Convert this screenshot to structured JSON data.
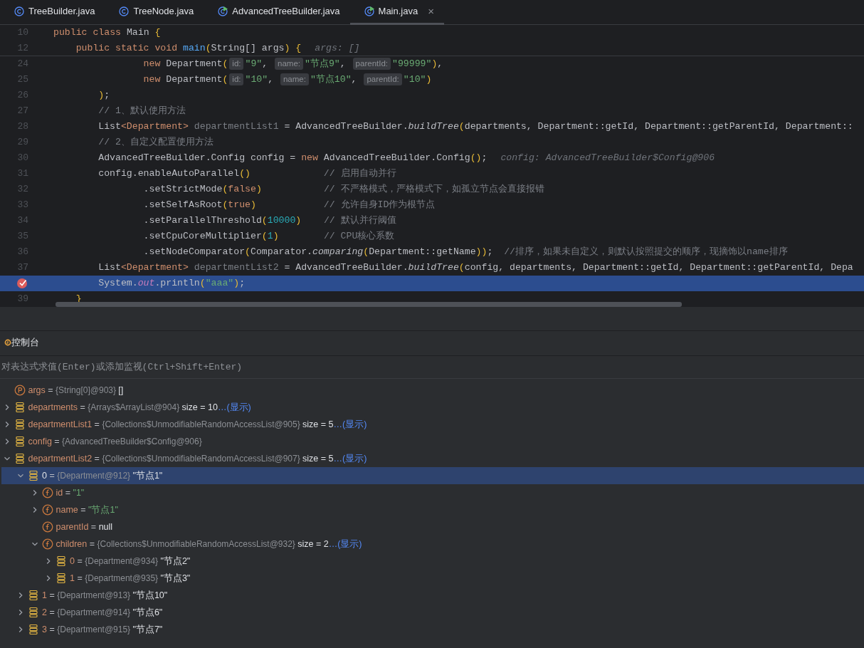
{
  "tabs": [
    {
      "label": "TreeBuilder.java",
      "kind": "class",
      "selected": false,
      "closable": false
    },
    {
      "label": "TreeNode.java",
      "kind": "class",
      "selected": false,
      "closable": false
    },
    {
      "label": "AdvancedTreeBuilder.java",
      "kind": "runnable",
      "selected": false,
      "closable": false
    },
    {
      "label": "Main.java",
      "kind": "runnable",
      "selected": true,
      "closable": true
    }
  ],
  "close_glyph": "×",
  "sticky_lines": [
    {
      "num": "10",
      "tokens": [
        {
          "kind": "kw",
          "text": "public class "
        },
        {
          "kind": "plain",
          "text": "Main "
        },
        {
          "kind": "brace",
          "text": "{"
        }
      ]
    },
    {
      "num": "12",
      "tokens": [
        {
          "kind": "kw",
          "text": "    public static void "
        },
        {
          "kind": "decl",
          "text": "main"
        },
        {
          "kind": "brace",
          "text": "("
        },
        {
          "kind": "plain",
          "text": "String[] args"
        },
        {
          "kind": "brace",
          "text": ")"
        },
        {
          "kind": "brace",
          "text": " {"
        },
        {
          "kind": "value",
          "text": "args: []"
        }
      ]
    }
  ],
  "lines": [
    {
      "num": "24",
      "breakpoint": false,
      "current": false,
      "tokens": [
        {
          "kind": "kw",
          "text": "                new "
        },
        {
          "kind": "plain",
          "text": "Department"
        },
        {
          "kind": "brace",
          "text": "("
        },
        {
          "kind": "hint",
          "text": "id:"
        },
        {
          "kind": "str",
          "text": "\"9\""
        },
        {
          "kind": "plain",
          "text": ", "
        },
        {
          "kind": "hint",
          "text": "name:"
        },
        {
          "kind": "str",
          "text": "\"节点9\""
        },
        {
          "kind": "plain",
          "text": ", "
        },
        {
          "kind": "hint",
          "text": "parentId:"
        },
        {
          "kind": "str",
          "text": "\"99999\""
        },
        {
          "kind": "brace",
          "text": ")"
        },
        {
          "kind": "plain",
          "text": ","
        }
      ]
    },
    {
      "num": "25",
      "breakpoint": false,
      "current": false,
      "tokens": [
        {
          "kind": "kw",
          "text": "                new "
        },
        {
          "kind": "plain",
          "text": "Department"
        },
        {
          "kind": "brace",
          "text": "("
        },
        {
          "kind": "hint",
          "text": "id:"
        },
        {
          "kind": "str",
          "text": "\"10\""
        },
        {
          "kind": "plain",
          "text": ", "
        },
        {
          "kind": "hint",
          "text": "name:"
        },
        {
          "kind": "str",
          "text": "\"节点10\""
        },
        {
          "kind": "plain",
          "text": ", "
        },
        {
          "kind": "hint",
          "text": "parentId:"
        },
        {
          "kind": "str",
          "text": "\"10\""
        },
        {
          "kind": "brace",
          "text": ")"
        }
      ]
    },
    {
      "num": "26",
      "breakpoint": false,
      "current": false,
      "tokens": [
        {
          "kind": "brace",
          "text": "        )"
        },
        {
          "kind": "plain",
          "text": ";"
        }
      ]
    },
    {
      "num": "27",
      "breakpoint": false,
      "current": false,
      "tokens": [
        {
          "kind": "comment",
          "text": "        // 1、默认使用方法"
        }
      ]
    },
    {
      "num": "28",
      "breakpoint": false,
      "current": false,
      "tokens": [
        {
          "kind": "plain",
          "text": "        List"
        },
        {
          "kind": "kw",
          "text": "<Department>"
        },
        {
          "kind": "dim",
          "text": " departmentList1"
        },
        {
          "kind": "plain",
          "text": " = AdvancedTreeBuilder."
        },
        {
          "kind": "italic",
          "text": "buildTree"
        },
        {
          "kind": "brace",
          "text": "("
        },
        {
          "kind": "plain",
          "text": "departments, Department::getId, Department::getParentId, Department::"
        }
      ]
    },
    {
      "num": "29",
      "breakpoint": false,
      "current": false,
      "tokens": [
        {
          "kind": "comment",
          "text": "        // 2、自定义配置使用方法"
        }
      ]
    },
    {
      "num": "30",
      "breakpoint": false,
      "current": false,
      "tokens": [
        {
          "kind": "plain",
          "text": "        AdvancedTreeBuilder.Config config = "
        },
        {
          "kind": "kw",
          "text": "new"
        },
        {
          "kind": "plain",
          "text": " AdvancedTreeBuilder.Config"
        },
        {
          "kind": "brace",
          "text": "()"
        },
        {
          "kind": "plain",
          "text": ";"
        },
        {
          "kind": "value",
          "text": "config: AdvancedTreeBuilder$Config@906"
        }
      ]
    },
    {
      "num": "31",
      "breakpoint": false,
      "current": false,
      "tokens": [
        {
          "kind": "plain",
          "text": "        config.enableAutoParallel"
        },
        {
          "kind": "brace",
          "text": "()"
        },
        {
          "kind": "acomment",
          "text": "// 启用自动并行"
        }
      ]
    },
    {
      "num": "32",
      "breakpoint": false,
      "current": false,
      "tokens": [
        {
          "kind": "plain",
          "text": "                .setStrictMode"
        },
        {
          "kind": "brace",
          "text": "("
        },
        {
          "kind": "kw",
          "text": "false"
        },
        {
          "kind": "brace",
          "text": ")"
        },
        {
          "kind": "acomment",
          "text": "// 不严格模式，严格模式下，如孤立节点会直接报错"
        }
      ]
    },
    {
      "num": "33",
      "breakpoint": false,
      "current": false,
      "tokens": [
        {
          "kind": "plain",
          "text": "                .setSelfAsRoot"
        },
        {
          "kind": "brace",
          "text": "("
        },
        {
          "kind": "kw",
          "text": "true"
        },
        {
          "kind": "brace",
          "text": ")"
        },
        {
          "kind": "acomment",
          "text": "// 允许自身ID作为根节点"
        }
      ]
    },
    {
      "num": "34",
      "breakpoint": false,
      "current": false,
      "tokens": [
        {
          "kind": "plain",
          "text": "                .setParallelThreshold"
        },
        {
          "kind": "brace",
          "text": "("
        },
        {
          "kind": "num",
          "text": "10000"
        },
        {
          "kind": "brace",
          "text": ")"
        },
        {
          "kind": "acomment",
          "text": "// 默认并行阈值"
        }
      ]
    },
    {
      "num": "35",
      "breakpoint": false,
      "current": false,
      "tokens": [
        {
          "kind": "plain",
          "text": "                .setCpuCoreMultiplier"
        },
        {
          "kind": "brace",
          "text": "("
        },
        {
          "kind": "num",
          "text": "1"
        },
        {
          "kind": "brace",
          "text": ")"
        },
        {
          "kind": "acomment",
          "text": "// CPU核心系数"
        }
      ]
    },
    {
      "num": "36",
      "breakpoint": false,
      "current": false,
      "tokens": [
        {
          "kind": "plain",
          "text": "                .setNodeComparator"
        },
        {
          "kind": "brace",
          "text": "("
        },
        {
          "kind": "plain",
          "text": "Comparator."
        },
        {
          "kind": "italic",
          "text": "comparing"
        },
        {
          "kind": "brace",
          "text": "("
        },
        {
          "kind": "plain",
          "text": "Department::getName"
        },
        {
          "kind": "brace",
          "text": "))"
        },
        {
          "kind": "plain",
          "text": ";"
        },
        {
          "kind": "ecomment",
          "text": "//排序，如果未自定义，则默认按照提交的顺序，现摘饰以name排序"
        }
      ]
    },
    {
      "num": "37",
      "breakpoint": false,
      "current": false,
      "tokens": [
        {
          "kind": "plain",
          "text": "        List"
        },
        {
          "kind": "kw",
          "text": "<Department>"
        },
        {
          "kind": "dim",
          "text": " departmentList2"
        },
        {
          "kind": "plain",
          "text": " = AdvancedTreeBuilder."
        },
        {
          "kind": "italic",
          "text": "buildTree"
        },
        {
          "kind": "brace",
          "text": "("
        },
        {
          "kind": "plain",
          "text": "config, departments, Department::getId, Department::getParentId, Depa"
        }
      ]
    },
    {
      "breakpoint": true,
      "current": true,
      "tokens": [
        {
          "kind": "plain",
          "text": "        System."
        },
        {
          "kind": "field",
          "text": "out"
        },
        {
          "kind": "plain",
          "text": ".println"
        },
        {
          "kind": "brace",
          "text": "("
        },
        {
          "kind": "str",
          "text": "\"aaa\""
        },
        {
          "kind": "brace",
          "text": ")"
        },
        {
          "kind": "plain",
          "text": ";"
        }
      ]
    },
    {
      "num": "39",
      "breakpoint": false,
      "current": false,
      "tokens": [
        {
          "kind": "brace",
          "text": "    }"
        }
      ]
    }
  ],
  "panel": {
    "tab_label": "控制台",
    "evaluate_placeholder": "对表达式求值(Enter)或添加监视(Ctrl+Shift+Enter)"
  },
  "variables": [
    {
      "kind": "param",
      "name": "args",
      "assign": "=",
      "type": "{String[0]@903}",
      "value": "[]",
      "selected": false
    },
    {
      "kind": "list",
      "name": "departments",
      "assign": "=",
      "type": "{Arrays$ArrayList@904}",
      "value": "size = 10",
      "link": "…(显示)",
      "expanded": false,
      "selected": false
    },
    {
      "kind": "list",
      "name": "departmentList1",
      "assign": "=",
      "type": "{Collections$UnmodifiableRandomAccessList@905}",
      "value": "size = 5",
      "link": "…(显示)",
      "expanded": false,
      "selected": false
    },
    {
      "kind": "list",
      "name": "config",
      "assign": "=",
      "type": "{AdvancedTreeBuilder$Config@906}",
      "expanded": false,
      "selected": false
    },
    {
      "kind": "list",
      "name": "departmentList2",
      "assign": "=",
      "type": "{Collections$UnmodifiableRandomAccessList@907}",
      "value": "size = 5",
      "link": "…(显示)",
      "expanded": true,
      "selected": false,
      "children": [
        {
          "kind": "list",
          "name": "0",
          "assign": "=",
          "type": "{Department@912}",
          "value": "\"节点1\"",
          "expanded": true,
          "selected": true,
          "children": [
            {
              "kind": "field",
              "name": "id",
              "assign": "=",
              "value": {
                "kind": "string",
                "text": "\"1\""
              },
              "expanded": false,
              "selected": false
            },
            {
              "kind": "field",
              "name": "name",
              "assign": "=",
              "value": {
                "kind": "string",
                "text": "\"节点1\""
              },
              "expanded": false,
              "selected": false
            },
            {
              "kind": "field",
              "name": "parentId",
              "assign": "=",
              "value": "null",
              "selected": false
            },
            {
              "kind": "field",
              "name": "children",
              "assign": "=",
              "type": "{Collections$UnmodifiableRandomAccessList@932}",
              "value": "size = 2",
              "link": "…(显示)",
              "expanded": true,
              "selected": false,
              "children": [
                {
                  "kind": "list",
                  "name": "0",
                  "assign": "=",
                  "type": "{Department@934}",
                  "value": "\"节点2\"",
                  "expanded": false,
                  "selected": false
                },
                {
                  "kind": "list",
                  "name": "1",
                  "assign": "=",
                  "type": "{Department@935}",
                  "value": "\"节点3\"",
                  "expanded": false,
                  "selected": false
                }
              ]
            }
          ]
        },
        {
          "kind": "list",
          "name": "1",
          "assign": "=",
          "type": "{Department@913}",
          "value": "\"节点10\"",
          "expanded": false,
          "selected": false
        },
        {
          "kind": "list",
          "name": "2",
          "assign": "=",
          "type": "{Department@914}",
          "value": "\"节点6\"",
          "expanded": false,
          "selected": false
        },
        {
          "kind": "list",
          "name": "3",
          "assign": "=",
          "type": "{Department@915}",
          "value": "\"节点7\"",
          "expanded": false,
          "selected": false
        }
      ]
    }
  ]
}
